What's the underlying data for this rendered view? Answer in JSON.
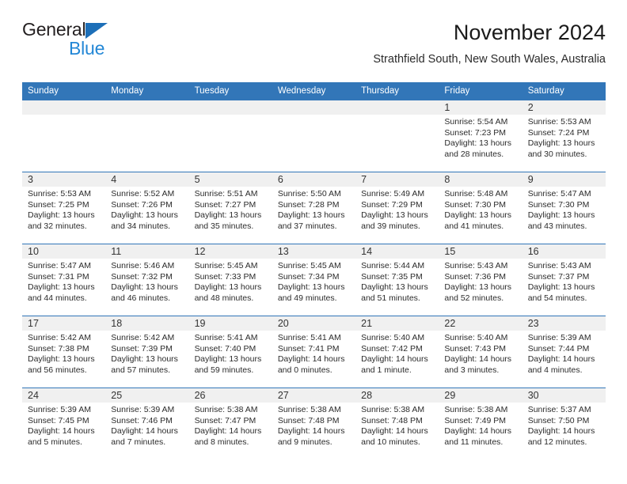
{
  "brand": {
    "name_top": "General",
    "name_bottom": "Blue",
    "triangle_color": "#1d6fb8",
    "blue_text_color": "#2387d6"
  },
  "header": {
    "title": "November 2024",
    "subtitle": "Strathfield South, New South Wales, Australia"
  },
  "colors": {
    "header_blue": "#3276b8",
    "daynum_band": "#f0f0f0",
    "text": "#2b2b2b"
  },
  "calendar": {
    "weekday_headers": [
      "Sunday",
      "Monday",
      "Tuesday",
      "Wednesday",
      "Thursday",
      "Friday",
      "Saturday"
    ],
    "labels": {
      "sunrise": "Sunrise:",
      "sunset": "Sunset:",
      "daylight": "Daylight:"
    },
    "weeks": [
      [
        {
          "day": "",
          "sunrise": "",
          "sunset": "",
          "daylight_line1": "",
          "daylight_line2": "",
          "empty": true
        },
        {
          "day": "",
          "sunrise": "",
          "sunset": "",
          "daylight_line1": "",
          "daylight_line2": "",
          "empty": true
        },
        {
          "day": "",
          "sunrise": "",
          "sunset": "",
          "daylight_line1": "",
          "daylight_line2": "",
          "empty": true
        },
        {
          "day": "",
          "sunrise": "",
          "sunset": "",
          "daylight_line1": "",
          "daylight_line2": "",
          "empty": true
        },
        {
          "day": "",
          "sunrise": "",
          "sunset": "",
          "daylight_line1": "",
          "daylight_line2": "",
          "empty": true
        },
        {
          "day": "1",
          "sunrise": "Sunrise: 5:54 AM",
          "sunset": "Sunset: 7:23 PM",
          "daylight_line1": "Daylight: 13 hours",
          "daylight_line2": "and 28 minutes."
        },
        {
          "day": "2",
          "sunrise": "Sunrise: 5:53 AM",
          "sunset": "Sunset: 7:24 PM",
          "daylight_line1": "Daylight: 13 hours",
          "daylight_line2": "and 30 minutes."
        }
      ],
      [
        {
          "day": "3",
          "sunrise": "Sunrise: 5:53 AM",
          "sunset": "Sunset: 7:25 PM",
          "daylight_line1": "Daylight: 13 hours",
          "daylight_line2": "and 32 minutes."
        },
        {
          "day": "4",
          "sunrise": "Sunrise: 5:52 AM",
          "sunset": "Sunset: 7:26 PM",
          "daylight_line1": "Daylight: 13 hours",
          "daylight_line2": "and 34 minutes."
        },
        {
          "day": "5",
          "sunrise": "Sunrise: 5:51 AM",
          "sunset": "Sunset: 7:27 PM",
          "daylight_line1": "Daylight: 13 hours",
          "daylight_line2": "and 35 minutes."
        },
        {
          "day": "6",
          "sunrise": "Sunrise: 5:50 AM",
          "sunset": "Sunset: 7:28 PM",
          "daylight_line1": "Daylight: 13 hours",
          "daylight_line2": "and 37 minutes."
        },
        {
          "day": "7",
          "sunrise": "Sunrise: 5:49 AM",
          "sunset": "Sunset: 7:29 PM",
          "daylight_line1": "Daylight: 13 hours",
          "daylight_line2": "and 39 minutes."
        },
        {
          "day": "8",
          "sunrise": "Sunrise: 5:48 AM",
          "sunset": "Sunset: 7:30 PM",
          "daylight_line1": "Daylight: 13 hours",
          "daylight_line2": "and 41 minutes."
        },
        {
          "day": "9",
          "sunrise": "Sunrise: 5:47 AM",
          "sunset": "Sunset: 7:30 PM",
          "daylight_line1": "Daylight: 13 hours",
          "daylight_line2": "and 43 minutes."
        }
      ],
      [
        {
          "day": "10",
          "sunrise": "Sunrise: 5:47 AM",
          "sunset": "Sunset: 7:31 PM",
          "daylight_line1": "Daylight: 13 hours",
          "daylight_line2": "and 44 minutes."
        },
        {
          "day": "11",
          "sunrise": "Sunrise: 5:46 AM",
          "sunset": "Sunset: 7:32 PM",
          "daylight_line1": "Daylight: 13 hours",
          "daylight_line2": "and 46 minutes."
        },
        {
          "day": "12",
          "sunrise": "Sunrise: 5:45 AM",
          "sunset": "Sunset: 7:33 PM",
          "daylight_line1": "Daylight: 13 hours",
          "daylight_line2": "and 48 minutes."
        },
        {
          "day": "13",
          "sunrise": "Sunrise: 5:45 AM",
          "sunset": "Sunset: 7:34 PM",
          "daylight_line1": "Daylight: 13 hours",
          "daylight_line2": "and 49 minutes."
        },
        {
          "day": "14",
          "sunrise": "Sunrise: 5:44 AM",
          "sunset": "Sunset: 7:35 PM",
          "daylight_line1": "Daylight: 13 hours",
          "daylight_line2": "and 51 minutes."
        },
        {
          "day": "15",
          "sunrise": "Sunrise: 5:43 AM",
          "sunset": "Sunset: 7:36 PM",
          "daylight_line1": "Daylight: 13 hours",
          "daylight_line2": "and 52 minutes."
        },
        {
          "day": "16",
          "sunrise": "Sunrise: 5:43 AM",
          "sunset": "Sunset: 7:37 PM",
          "daylight_line1": "Daylight: 13 hours",
          "daylight_line2": "and 54 minutes."
        }
      ],
      [
        {
          "day": "17",
          "sunrise": "Sunrise: 5:42 AM",
          "sunset": "Sunset: 7:38 PM",
          "daylight_line1": "Daylight: 13 hours",
          "daylight_line2": "and 56 minutes."
        },
        {
          "day": "18",
          "sunrise": "Sunrise: 5:42 AM",
          "sunset": "Sunset: 7:39 PM",
          "daylight_line1": "Daylight: 13 hours",
          "daylight_line2": "and 57 minutes."
        },
        {
          "day": "19",
          "sunrise": "Sunrise: 5:41 AM",
          "sunset": "Sunset: 7:40 PM",
          "daylight_line1": "Daylight: 13 hours",
          "daylight_line2": "and 59 minutes."
        },
        {
          "day": "20",
          "sunrise": "Sunrise: 5:41 AM",
          "sunset": "Sunset: 7:41 PM",
          "daylight_line1": "Daylight: 14 hours",
          "daylight_line2": "and 0 minutes."
        },
        {
          "day": "21",
          "sunrise": "Sunrise: 5:40 AM",
          "sunset": "Sunset: 7:42 PM",
          "daylight_line1": "Daylight: 14 hours",
          "daylight_line2": "and 1 minute."
        },
        {
          "day": "22",
          "sunrise": "Sunrise: 5:40 AM",
          "sunset": "Sunset: 7:43 PM",
          "daylight_line1": "Daylight: 14 hours",
          "daylight_line2": "and 3 minutes."
        },
        {
          "day": "23",
          "sunrise": "Sunrise: 5:39 AM",
          "sunset": "Sunset: 7:44 PM",
          "daylight_line1": "Daylight: 14 hours",
          "daylight_line2": "and 4 minutes."
        }
      ],
      [
        {
          "day": "24",
          "sunrise": "Sunrise: 5:39 AM",
          "sunset": "Sunset: 7:45 PM",
          "daylight_line1": "Daylight: 14 hours",
          "daylight_line2": "and 5 minutes."
        },
        {
          "day": "25",
          "sunrise": "Sunrise: 5:39 AM",
          "sunset": "Sunset: 7:46 PM",
          "daylight_line1": "Daylight: 14 hours",
          "daylight_line2": "and 7 minutes."
        },
        {
          "day": "26",
          "sunrise": "Sunrise: 5:38 AM",
          "sunset": "Sunset: 7:47 PM",
          "daylight_line1": "Daylight: 14 hours",
          "daylight_line2": "and 8 minutes."
        },
        {
          "day": "27",
          "sunrise": "Sunrise: 5:38 AM",
          "sunset": "Sunset: 7:48 PM",
          "daylight_line1": "Daylight: 14 hours",
          "daylight_line2": "and 9 minutes."
        },
        {
          "day": "28",
          "sunrise": "Sunrise: 5:38 AM",
          "sunset": "Sunset: 7:48 PM",
          "daylight_line1": "Daylight: 14 hours",
          "daylight_line2": "and 10 minutes."
        },
        {
          "day": "29",
          "sunrise": "Sunrise: 5:38 AM",
          "sunset": "Sunset: 7:49 PM",
          "daylight_line1": "Daylight: 14 hours",
          "daylight_line2": "and 11 minutes."
        },
        {
          "day": "30",
          "sunrise": "Sunrise: 5:37 AM",
          "sunset": "Sunset: 7:50 PM",
          "daylight_line1": "Daylight: 14 hours",
          "daylight_line2": "and 12 minutes."
        }
      ]
    ]
  }
}
